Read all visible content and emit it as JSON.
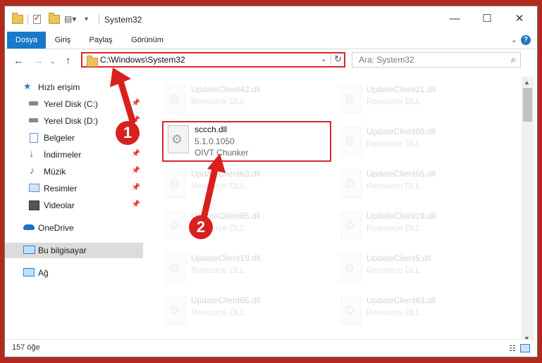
{
  "window": {
    "title": "System32"
  },
  "ribbon": {
    "tabs": [
      "Dosya",
      "Giriş",
      "Paylaş",
      "Görünüm"
    ]
  },
  "nav": {
    "address": "C:\\Windows\\System32",
    "search_placeholder": "Ara: System32"
  },
  "sidebar": {
    "items": [
      {
        "label": "Hızlı erişim",
        "icon": "star-icon"
      },
      {
        "label": "Yerel Disk (C:)",
        "icon": "drive-icon",
        "pinned": true
      },
      {
        "label": "Yerel Disk (D:)",
        "icon": "drive-icon",
        "pinned": true
      },
      {
        "label": "Belgeler",
        "icon": "documents-icon",
        "pinned": true
      },
      {
        "label": "İndirmeler",
        "icon": "download-icon",
        "pinned": true
      },
      {
        "label": "Müzik",
        "icon": "music-icon",
        "pinned": true
      },
      {
        "label": "Resimler",
        "icon": "pictures-icon",
        "pinned": true
      },
      {
        "label": "Videolar",
        "icon": "video-icon",
        "pinned": true
      },
      {
        "label": "OneDrive",
        "icon": "cloud-icon"
      },
      {
        "label": "Bu bilgisayar",
        "icon": "computer-icon",
        "selected": true
      },
      {
        "label": "Ağ",
        "icon": "network-icon"
      }
    ]
  },
  "files": {
    "left": [
      {
        "name": "UpdateClient42.dll",
        "type": "Resource DLL"
      },
      {
        "name": "UpdateClient63.dll",
        "type": "Resource DLL"
      },
      {
        "name": "UpdateClient65.dll",
        "type": "Resource DLL"
      },
      {
        "name": "UpdateClient19.dll",
        "type": "Resource DLL"
      },
      {
        "name": "UpdateClient65.dll",
        "type": "Resource DLL"
      }
    ],
    "right": [
      {
        "name": "UpdateClient21.dll",
        "type": "Resource DLL"
      },
      {
        "name": "UpdateClient65.dll",
        "type": "Resource DLL"
      },
      {
        "name": "UpdateClient65.dll",
        "type": "Resource DLL"
      },
      {
        "name": "UpdateClient19.dll",
        "type": "Resource DLL"
      },
      {
        "name": "UpdateClient5.dll",
        "type": "Resource DLL"
      },
      {
        "name": "UpdateClient63.dll",
        "type": "Resource DLL"
      }
    ],
    "highlight": {
      "name": "sccch.dll",
      "version": "5.1.0.1050",
      "description": "OIVT Chunker"
    }
  },
  "status": {
    "count": "157 öğe"
  },
  "callouts": [
    "1",
    "2"
  ],
  "colors": {
    "accent": "#1979ca",
    "highlight": "#d9252b"
  }
}
